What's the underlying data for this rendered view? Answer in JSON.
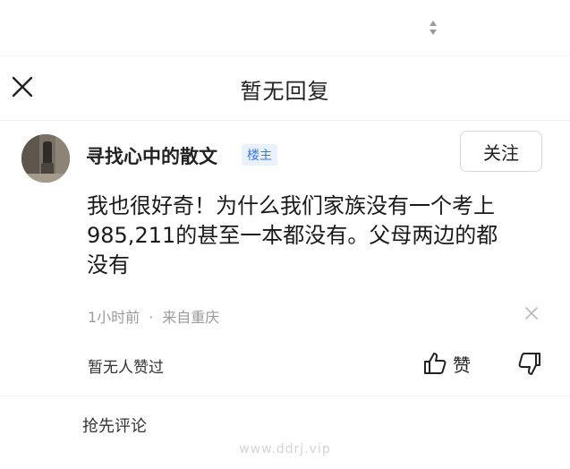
{
  "header": {
    "title": "暂无回复"
  },
  "comment": {
    "username": "寻找心中的散文",
    "op_badge": "楼主",
    "follow_label": "关注",
    "body": "我也很好奇！为什么我们家族没有一个考上\n985,211的甚至一本都没有。父母两边的都\n没有",
    "time": "1小时前",
    "separator": "·",
    "location": "来自重庆",
    "likes_text": "暂无人赞过",
    "like_label": "赞"
  },
  "reply": {
    "prompt": "抢先评论"
  },
  "watermark": "www.ddrj.vip",
  "colors": {
    "badge_text": "#3f79d8",
    "badge_bg": "#e9f1fd",
    "meta_text": "#9a9a9a"
  },
  "icons": {
    "sort": "sort-arrows-icon",
    "close": "close-icon",
    "dismiss": "dismiss-icon",
    "like": "thumbs-up-icon",
    "dislike": "thumbs-down-icon"
  }
}
